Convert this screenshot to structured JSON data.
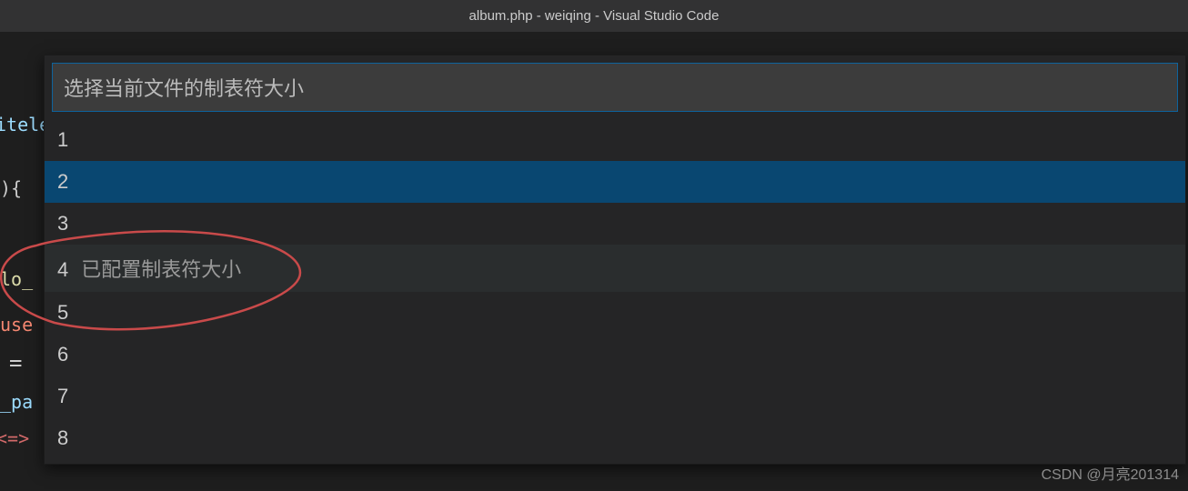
{
  "titlebar": {
    "title": "album.php - weiqing - Visual Studio Code"
  },
  "quickpick": {
    "placeholder": "选择当前文件的制表符大小",
    "options": [
      {
        "label": "1",
        "desc": ""
      },
      {
        "label": "2",
        "desc": ""
      },
      {
        "label": "3",
        "desc": ""
      },
      {
        "label": "4",
        "desc": "已配置制表符大小"
      },
      {
        "label": "5",
        "desc": ""
      },
      {
        "label": "6",
        "desc": ""
      },
      {
        "label": "7",
        "desc": ""
      },
      {
        "label": "8",
        "desc": ""
      }
    ],
    "selected_index": 1,
    "hovered_index": 3
  },
  "code_fragments": {
    "tele": "itele",
    "brace": "){",
    "lo": "lo_",
    "use": "use",
    "eq": "=",
    "pa": "_pa",
    "arrow": "<=>"
  },
  "watermark": "CSDN @月亮201314"
}
